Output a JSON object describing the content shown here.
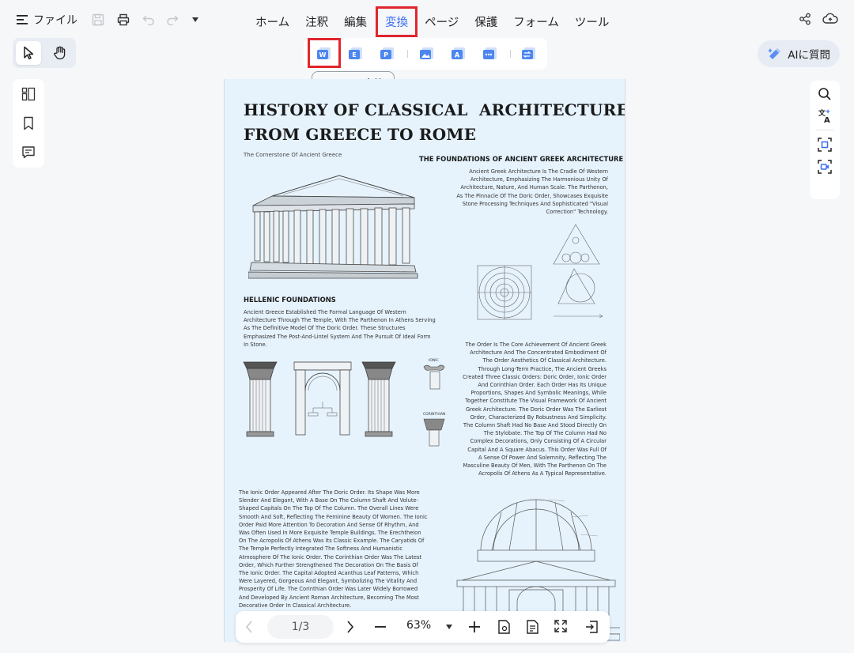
{
  "file_menu": {
    "label": "ファイル"
  },
  "menu_tabs": [
    {
      "label": "ホーム"
    },
    {
      "label": "注釈"
    },
    {
      "label": "編集"
    },
    {
      "label": "変換"
    },
    {
      "label": "ページ"
    },
    {
      "label": "保護"
    },
    {
      "label": "フォーム"
    },
    {
      "label": "ツール"
    }
  ],
  "active_tab": "変換",
  "tooltip": "Wordに変換",
  "ai_button": {
    "label": "AIに質問"
  },
  "document": {
    "title": "HISTORY OF CLASSICAL  ARCHITECTURE:\nFROM GREECE TO ROME",
    "subtitle": "The Cornerstone Of Ancient Greece",
    "section1_heading": "THE FOUNDATIONS OF ANCIENT GREEK ARCHITECTURE",
    "section1_text": "Ancient Greek Architecture Is The Cradle Of Western\nArchitecture, Emphasizing The Harmonious Unity Of\nArchitecture, Nature, And Human Scale. The Parthenon,\nAs The Pinnacle Of The Doric Order, Showcases Exquisite\nStone Processing Techniques And Sophisticated \"Visual\nCorrection\" Technology.",
    "section2_heading": "HELLENIC FOUNDATIONS",
    "section2_text": "Ancient Greece Established The Formal Language Of Western\nArchitecture Through The Temple, With The Parthenon In Athens Serving\nAs The Definitive Model Of The Doric Order. These Structures\nEmphasized The Post-And-Lintel System And The Pursuit Of Ideal Form\nIn Stone.",
    "section3_text": "The Order Is The Core Achievement Of Ancient Greek\nArchitecture And The Concentrated Embodiment Of\nThe Order Aesthetics Of Classical Architecture.\nThrough Long-Term Practice, The Ancient Greeks\nCreated Three Classic Orders: Doric Order, Ionic Order\nAnd Corinthian Order. Each Order Has Its Unique\nProportions, Shapes And Symbolic Meanings, While\nTogether Constitute The Visual Framework Of Ancient\nGreek Architecture. The Doric Order Was The Earliest\nOrder, Characterized By Robustness And Simplicity.\nThe Column Shaft Had No Base And Stood Directly On\nThe Stylobate. The Top Of The Column Had No\nComplex Decorations, Only Consisting Of A Circular\nCapital And A Square Abacus. This Order Was Full Of\nA Sense Of Power And Solemnity, Reflecting The\nMasculine Beauty Of Men, With The Parthenon On The\nAcropolis Of Athens As A Typical Representative.",
    "section4_text": "The Ionic Order Appeared After The Doric Order. Its Shape Was More\nSlender And Elegant, With A Base On The Column Shaft And Volute-\nShaped Capitals On The Top Of The Column. The Overall Lines Were\nSmooth And Soft, Reflecting The Feminine Beauty Of Women. The Ionic\nOrder Paid More Attention To Decoration And Sense Of Rhythm, And\nWas Often Used In More Exquisite Temple Buildings. The Erechtheion\nOn The Acropolis Of Athens Was Its Classic Example. The Caryatids Of\nThe Temple Perfectly Integrated The Softness And Humanistic\nAtmosphere Of The Ionic Order. The Corinthian Order Was The Latest\nOrder, Which Further Strengthened The Decoration On The Basis Of\nThe Ionic Order. The Capital Adopted Acanthus Leaf Patterns, Which\nWere Layered, Gorgeous And Elegant, Symbolizing The Vitality And\nProsperity Of Life. The Corinthian Order Was Later Widely Borrowed\nAnd Developed By Ancient Roman Architecture, Becoming The Most\nDecorative Order In Classical Architecture.",
    "label_ionic": "IONIC",
    "label_corinthian": "CORINTHIAN"
  },
  "bottom_bar": {
    "page_indicator": "1/3",
    "zoom": "63%"
  },
  "colors": {
    "accent": "#3a6df0",
    "highlight": "#e0262d",
    "page_bg": "#e6f3fd"
  }
}
